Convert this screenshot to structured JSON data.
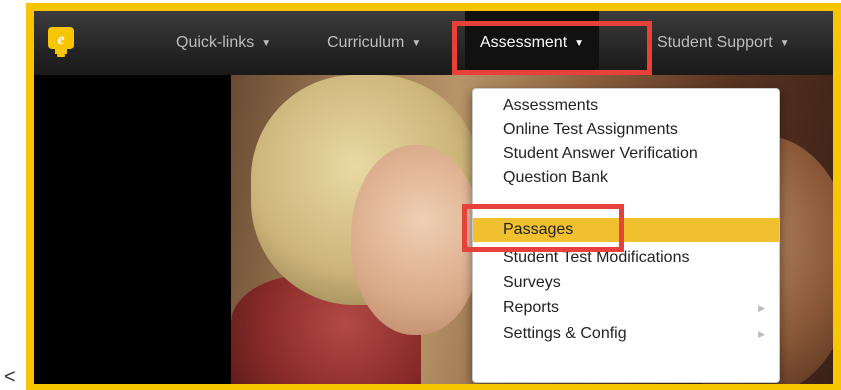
{
  "fragment": "<",
  "brand": {
    "logo_letter": "e",
    "logo_color": "#f7c600"
  },
  "nav": {
    "items": [
      {
        "label": "Quick-links"
      },
      {
        "label": "Curriculum"
      },
      {
        "label": "Assessment"
      },
      {
        "label": "Student Support"
      }
    ]
  },
  "dropdown": {
    "items": [
      {
        "label": "Assessments"
      },
      {
        "label": "Online Test Assignments"
      },
      {
        "label": "Student Answer Verification"
      },
      {
        "label": "Question Bank"
      },
      {
        "label": "Passages"
      },
      {
        "label": "Student Test Modifications"
      },
      {
        "label": "Surveys"
      },
      {
        "label": "Reports"
      },
      {
        "label": "Settings & Config"
      }
    ]
  },
  "colors": {
    "frame": "#f7c600",
    "highlight": "#e8413c",
    "selected_item": "#f0c02e"
  }
}
